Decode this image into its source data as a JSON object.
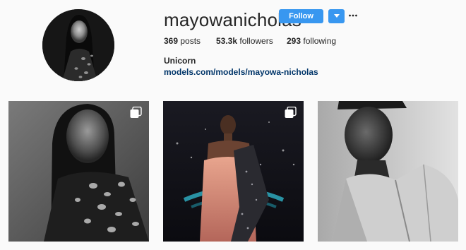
{
  "profile": {
    "username": "mayowanicholas",
    "follow_label": "Follow",
    "dropdown_icon": "chevron-down-icon",
    "more_icon": "more-options-icon",
    "stats": {
      "posts": "369",
      "posts_label": "posts",
      "followers": "53.3k",
      "followers_label": "followers",
      "following": "293",
      "following_label": "following"
    },
    "full_name": "Unicorn",
    "website": "models.com/models/mayowa-nicholas"
  },
  "posts": [
    {
      "type": "carousel",
      "icon": "multiple-photos-icon",
      "tone": "black-and-white"
    },
    {
      "type": "carousel",
      "icon": "multiple-photos-icon",
      "tone": "color"
    },
    {
      "type": "single",
      "tone": "black-and-white"
    }
  ],
  "colors": {
    "accent": "#3897f0",
    "link": "#003569",
    "background": "#fafafa",
    "text": "#262626"
  }
}
